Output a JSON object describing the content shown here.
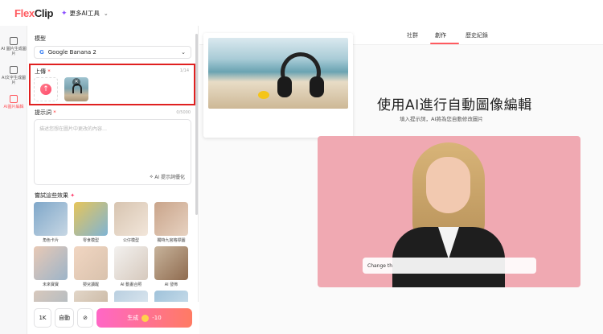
{
  "app": {
    "logo_flex": "Flex",
    "logo_clip": "Clip",
    "more_ai_tools": "更多AI工具"
  },
  "rail": [
    {
      "label": "AI 圖片生成圖片"
    },
    {
      "label": "AI文字生成圖片"
    },
    {
      "label": "AI圖片編輯"
    }
  ],
  "panel": {
    "model_label": "模型",
    "model_value": "Google Banana 2",
    "upload_label": "上傳",
    "upload_count": "1/14",
    "prompt_label": "提示詞",
    "prompt_count": "0/5000",
    "prompt_placeholder": "描述您想在圖片中更改的內容…",
    "enhance_label": "AI 提示詞優化",
    "effects_title": "嘗試這些效果",
    "effects": [
      {
        "caption": "角色卡片"
      },
      {
        "caption": "零食模型"
      },
      {
        "caption": "公仔模型"
      },
      {
        "caption": "獨特九宮格標圖"
      },
      {
        "caption": "未來寶寶"
      },
      {
        "caption": "嬰兒讀醒"
      },
      {
        "caption": "AI 動畫合照"
      },
      {
        "caption": "AI 發佈"
      }
    ],
    "resolution": "1K",
    "ratio": "自動",
    "generate_label": "生成",
    "generate_cost": "-10"
  },
  "main": {
    "tabs": [
      "社群",
      "創作",
      "歷史紀錄"
    ],
    "active_tab": "創作",
    "headline": "使用AI進行自動圖像編輯",
    "subline": "填入提示詞，AI將為您自動修改圖片",
    "edit_input_value": "Change th"
  },
  "colors": {
    "accent": "#ff5a5f",
    "highlight_border": "#e02020",
    "generate_start": "#ff67c6",
    "generate_end": "#ff7b63"
  }
}
